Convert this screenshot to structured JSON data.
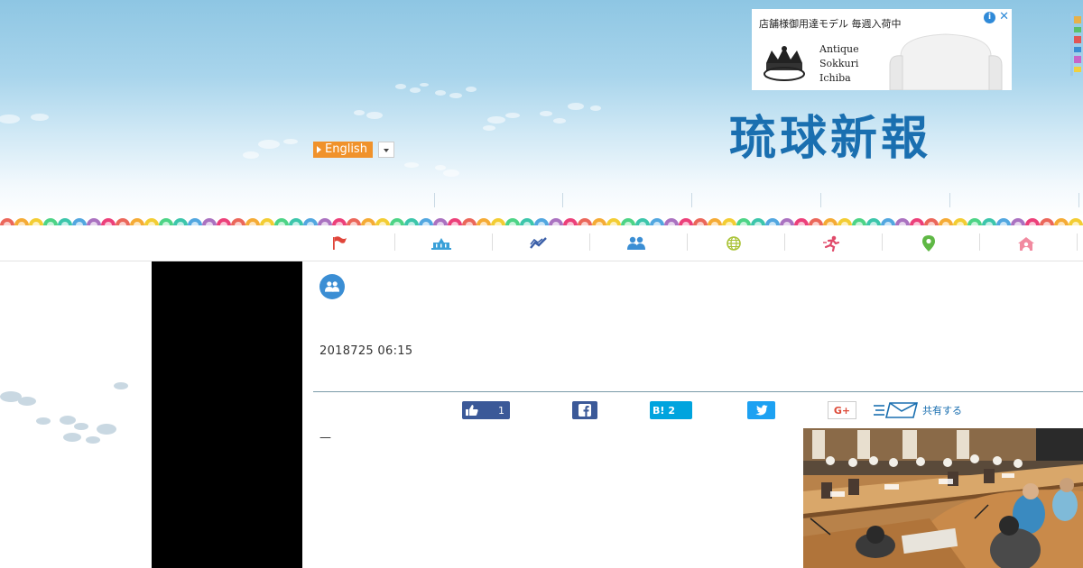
{
  "header": {
    "logo_text": "琉球新報",
    "language": {
      "label": "English",
      "dropdown": "chevron-down-icon"
    }
  },
  "ad": {
    "headline": "店舗様御用達モデル 毎週入荷中",
    "brand_line1": "Antique",
    "brand_line2": "Sokkuri",
    "brand_line3": "Ichiba",
    "info_icon": "i",
    "close_icon": "✕"
  },
  "nav": {
    "items": [
      {
        "id": "flag",
        "icon": "flag-icon",
        "color": "#e0453a"
      },
      {
        "id": "politics",
        "icon": "assembly-icon",
        "color": "#3aa0d8"
      },
      {
        "id": "economy",
        "icon": "chart-line-icon",
        "color": "#3b5fa8"
      },
      {
        "id": "society",
        "icon": "people-icon",
        "color": "#3b8ed4"
      },
      {
        "id": "world",
        "icon": "globe-icon",
        "color": "#a8c234"
      },
      {
        "id": "sports",
        "icon": "runner-icon",
        "color": "#e04a6a"
      },
      {
        "id": "local",
        "icon": "map-pin-icon",
        "color": "#5fb845"
      },
      {
        "id": "home",
        "icon": "home-icon",
        "color": "#f18aa0"
      }
    ]
  },
  "article": {
    "category_icon": "people-icon",
    "date": "2018725 06:15",
    "lead": "—"
  },
  "share": {
    "like_count": "1",
    "hatena_label": "B!",
    "hatena_count": "2",
    "gplus_label": "G+",
    "share_label": "共有する"
  }
}
